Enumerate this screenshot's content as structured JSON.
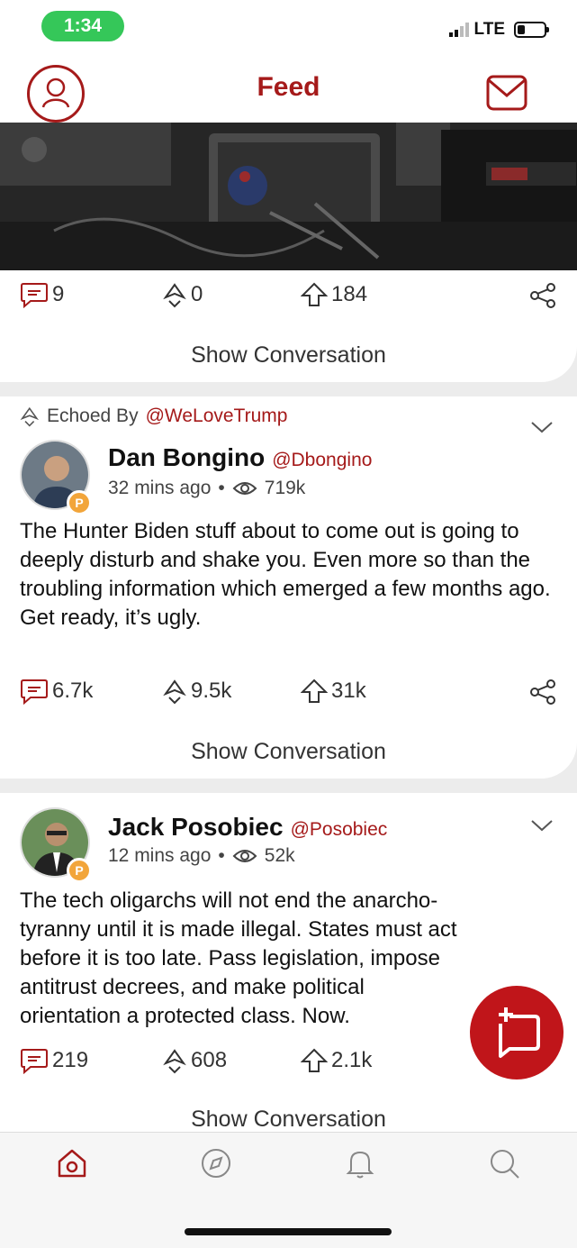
{
  "status": {
    "time": "1:34",
    "network": "LTE"
  },
  "header": {
    "title": "Feed",
    "profile_icon": "profile-icon",
    "mail_icon": "mail-icon"
  },
  "colors": {
    "brand": "#a51a1a",
    "fab": "#c0151a",
    "status_green": "#35c759",
    "badge": "#f2a53a"
  },
  "posts": [
    {
      "has_image": true,
      "counts": {
        "comments": "9",
        "echoes": "0",
        "upvotes": "184"
      },
      "show_conversation": "Show Conversation"
    },
    {
      "echoed_by_label": "Echoed By",
      "echoed_by_handle": "@WeLoveTrump",
      "author": {
        "name": "Dan Bongino",
        "handle": "@Dbongino",
        "badge": "P"
      },
      "time": "32 mins ago",
      "views": "719k",
      "text": "The Hunter Biden stuff about to come out is going to deeply disturb and shake you. Even more so than the troubling information which emerged a few months ago. Get ready, it’s ugly.",
      "counts": {
        "comments": "6.7k",
        "echoes": "9.5k",
        "upvotes": "31k"
      },
      "show_conversation": "Show Conversation"
    },
    {
      "author": {
        "name": "Jack Posobiec",
        "handle": "@Posobiec",
        "badge": "P"
      },
      "time": "12 mins ago",
      "views": "52k",
      "text": "The tech oligarchs will not end the anarcho-tyranny until it is made illegal. States must act before it is too late. Pass legislation, impose antitrust decrees, and make political orientation a protected class. Now.",
      "counts": {
        "comments": "219",
        "echoes": "608",
        "upvotes": "2.1k"
      },
      "show_conversation": "Show Conversation"
    }
  ],
  "tabs": [
    "home-icon",
    "discover-icon",
    "notifications-icon",
    "search-icon"
  ],
  "fab_icon": "compose-icon"
}
